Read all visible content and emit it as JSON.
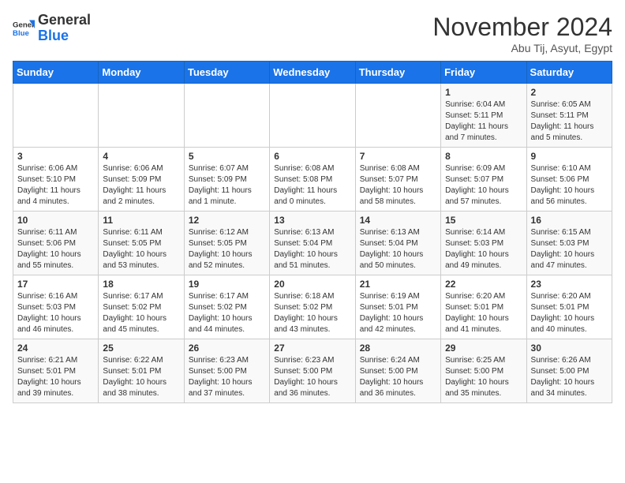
{
  "header": {
    "logo_general": "General",
    "logo_blue": "Blue",
    "month_title": "November 2024",
    "subtitle": "Abu Tij, Asyut, Egypt"
  },
  "weekdays": [
    "Sunday",
    "Monday",
    "Tuesday",
    "Wednesday",
    "Thursday",
    "Friday",
    "Saturday"
  ],
  "weeks": [
    [
      {
        "day": "",
        "info": ""
      },
      {
        "day": "",
        "info": ""
      },
      {
        "day": "",
        "info": ""
      },
      {
        "day": "",
        "info": ""
      },
      {
        "day": "",
        "info": ""
      },
      {
        "day": "1",
        "info": "Sunrise: 6:04 AM\nSunset: 5:11 PM\nDaylight: 11 hours\nand 7 minutes."
      },
      {
        "day": "2",
        "info": "Sunrise: 6:05 AM\nSunset: 5:11 PM\nDaylight: 11 hours\nand 5 minutes."
      }
    ],
    [
      {
        "day": "3",
        "info": "Sunrise: 6:06 AM\nSunset: 5:10 PM\nDaylight: 11 hours\nand 4 minutes."
      },
      {
        "day": "4",
        "info": "Sunrise: 6:06 AM\nSunset: 5:09 PM\nDaylight: 11 hours\nand 2 minutes."
      },
      {
        "day": "5",
        "info": "Sunrise: 6:07 AM\nSunset: 5:09 PM\nDaylight: 11 hours\nand 1 minute."
      },
      {
        "day": "6",
        "info": "Sunrise: 6:08 AM\nSunset: 5:08 PM\nDaylight: 11 hours\nand 0 minutes."
      },
      {
        "day": "7",
        "info": "Sunrise: 6:08 AM\nSunset: 5:07 PM\nDaylight: 10 hours\nand 58 minutes."
      },
      {
        "day": "8",
        "info": "Sunrise: 6:09 AM\nSunset: 5:07 PM\nDaylight: 10 hours\nand 57 minutes."
      },
      {
        "day": "9",
        "info": "Sunrise: 6:10 AM\nSunset: 5:06 PM\nDaylight: 10 hours\nand 56 minutes."
      }
    ],
    [
      {
        "day": "10",
        "info": "Sunrise: 6:11 AM\nSunset: 5:06 PM\nDaylight: 10 hours\nand 55 minutes."
      },
      {
        "day": "11",
        "info": "Sunrise: 6:11 AM\nSunset: 5:05 PM\nDaylight: 10 hours\nand 53 minutes."
      },
      {
        "day": "12",
        "info": "Sunrise: 6:12 AM\nSunset: 5:05 PM\nDaylight: 10 hours\nand 52 minutes."
      },
      {
        "day": "13",
        "info": "Sunrise: 6:13 AM\nSunset: 5:04 PM\nDaylight: 10 hours\nand 51 minutes."
      },
      {
        "day": "14",
        "info": "Sunrise: 6:13 AM\nSunset: 5:04 PM\nDaylight: 10 hours\nand 50 minutes."
      },
      {
        "day": "15",
        "info": "Sunrise: 6:14 AM\nSunset: 5:03 PM\nDaylight: 10 hours\nand 49 minutes."
      },
      {
        "day": "16",
        "info": "Sunrise: 6:15 AM\nSunset: 5:03 PM\nDaylight: 10 hours\nand 47 minutes."
      }
    ],
    [
      {
        "day": "17",
        "info": "Sunrise: 6:16 AM\nSunset: 5:03 PM\nDaylight: 10 hours\nand 46 minutes."
      },
      {
        "day": "18",
        "info": "Sunrise: 6:17 AM\nSunset: 5:02 PM\nDaylight: 10 hours\nand 45 minutes."
      },
      {
        "day": "19",
        "info": "Sunrise: 6:17 AM\nSunset: 5:02 PM\nDaylight: 10 hours\nand 44 minutes."
      },
      {
        "day": "20",
        "info": "Sunrise: 6:18 AM\nSunset: 5:02 PM\nDaylight: 10 hours\nand 43 minutes."
      },
      {
        "day": "21",
        "info": "Sunrise: 6:19 AM\nSunset: 5:01 PM\nDaylight: 10 hours\nand 42 minutes."
      },
      {
        "day": "22",
        "info": "Sunrise: 6:20 AM\nSunset: 5:01 PM\nDaylight: 10 hours\nand 41 minutes."
      },
      {
        "day": "23",
        "info": "Sunrise: 6:20 AM\nSunset: 5:01 PM\nDaylight: 10 hours\nand 40 minutes."
      }
    ],
    [
      {
        "day": "24",
        "info": "Sunrise: 6:21 AM\nSunset: 5:01 PM\nDaylight: 10 hours\nand 39 minutes."
      },
      {
        "day": "25",
        "info": "Sunrise: 6:22 AM\nSunset: 5:01 PM\nDaylight: 10 hours\nand 38 minutes."
      },
      {
        "day": "26",
        "info": "Sunrise: 6:23 AM\nSunset: 5:00 PM\nDaylight: 10 hours\nand 37 minutes."
      },
      {
        "day": "27",
        "info": "Sunrise: 6:23 AM\nSunset: 5:00 PM\nDaylight: 10 hours\nand 36 minutes."
      },
      {
        "day": "28",
        "info": "Sunrise: 6:24 AM\nSunset: 5:00 PM\nDaylight: 10 hours\nand 36 minutes."
      },
      {
        "day": "29",
        "info": "Sunrise: 6:25 AM\nSunset: 5:00 PM\nDaylight: 10 hours\nand 35 minutes."
      },
      {
        "day": "30",
        "info": "Sunrise: 6:26 AM\nSunset: 5:00 PM\nDaylight: 10 hours\nand 34 minutes."
      }
    ]
  ]
}
